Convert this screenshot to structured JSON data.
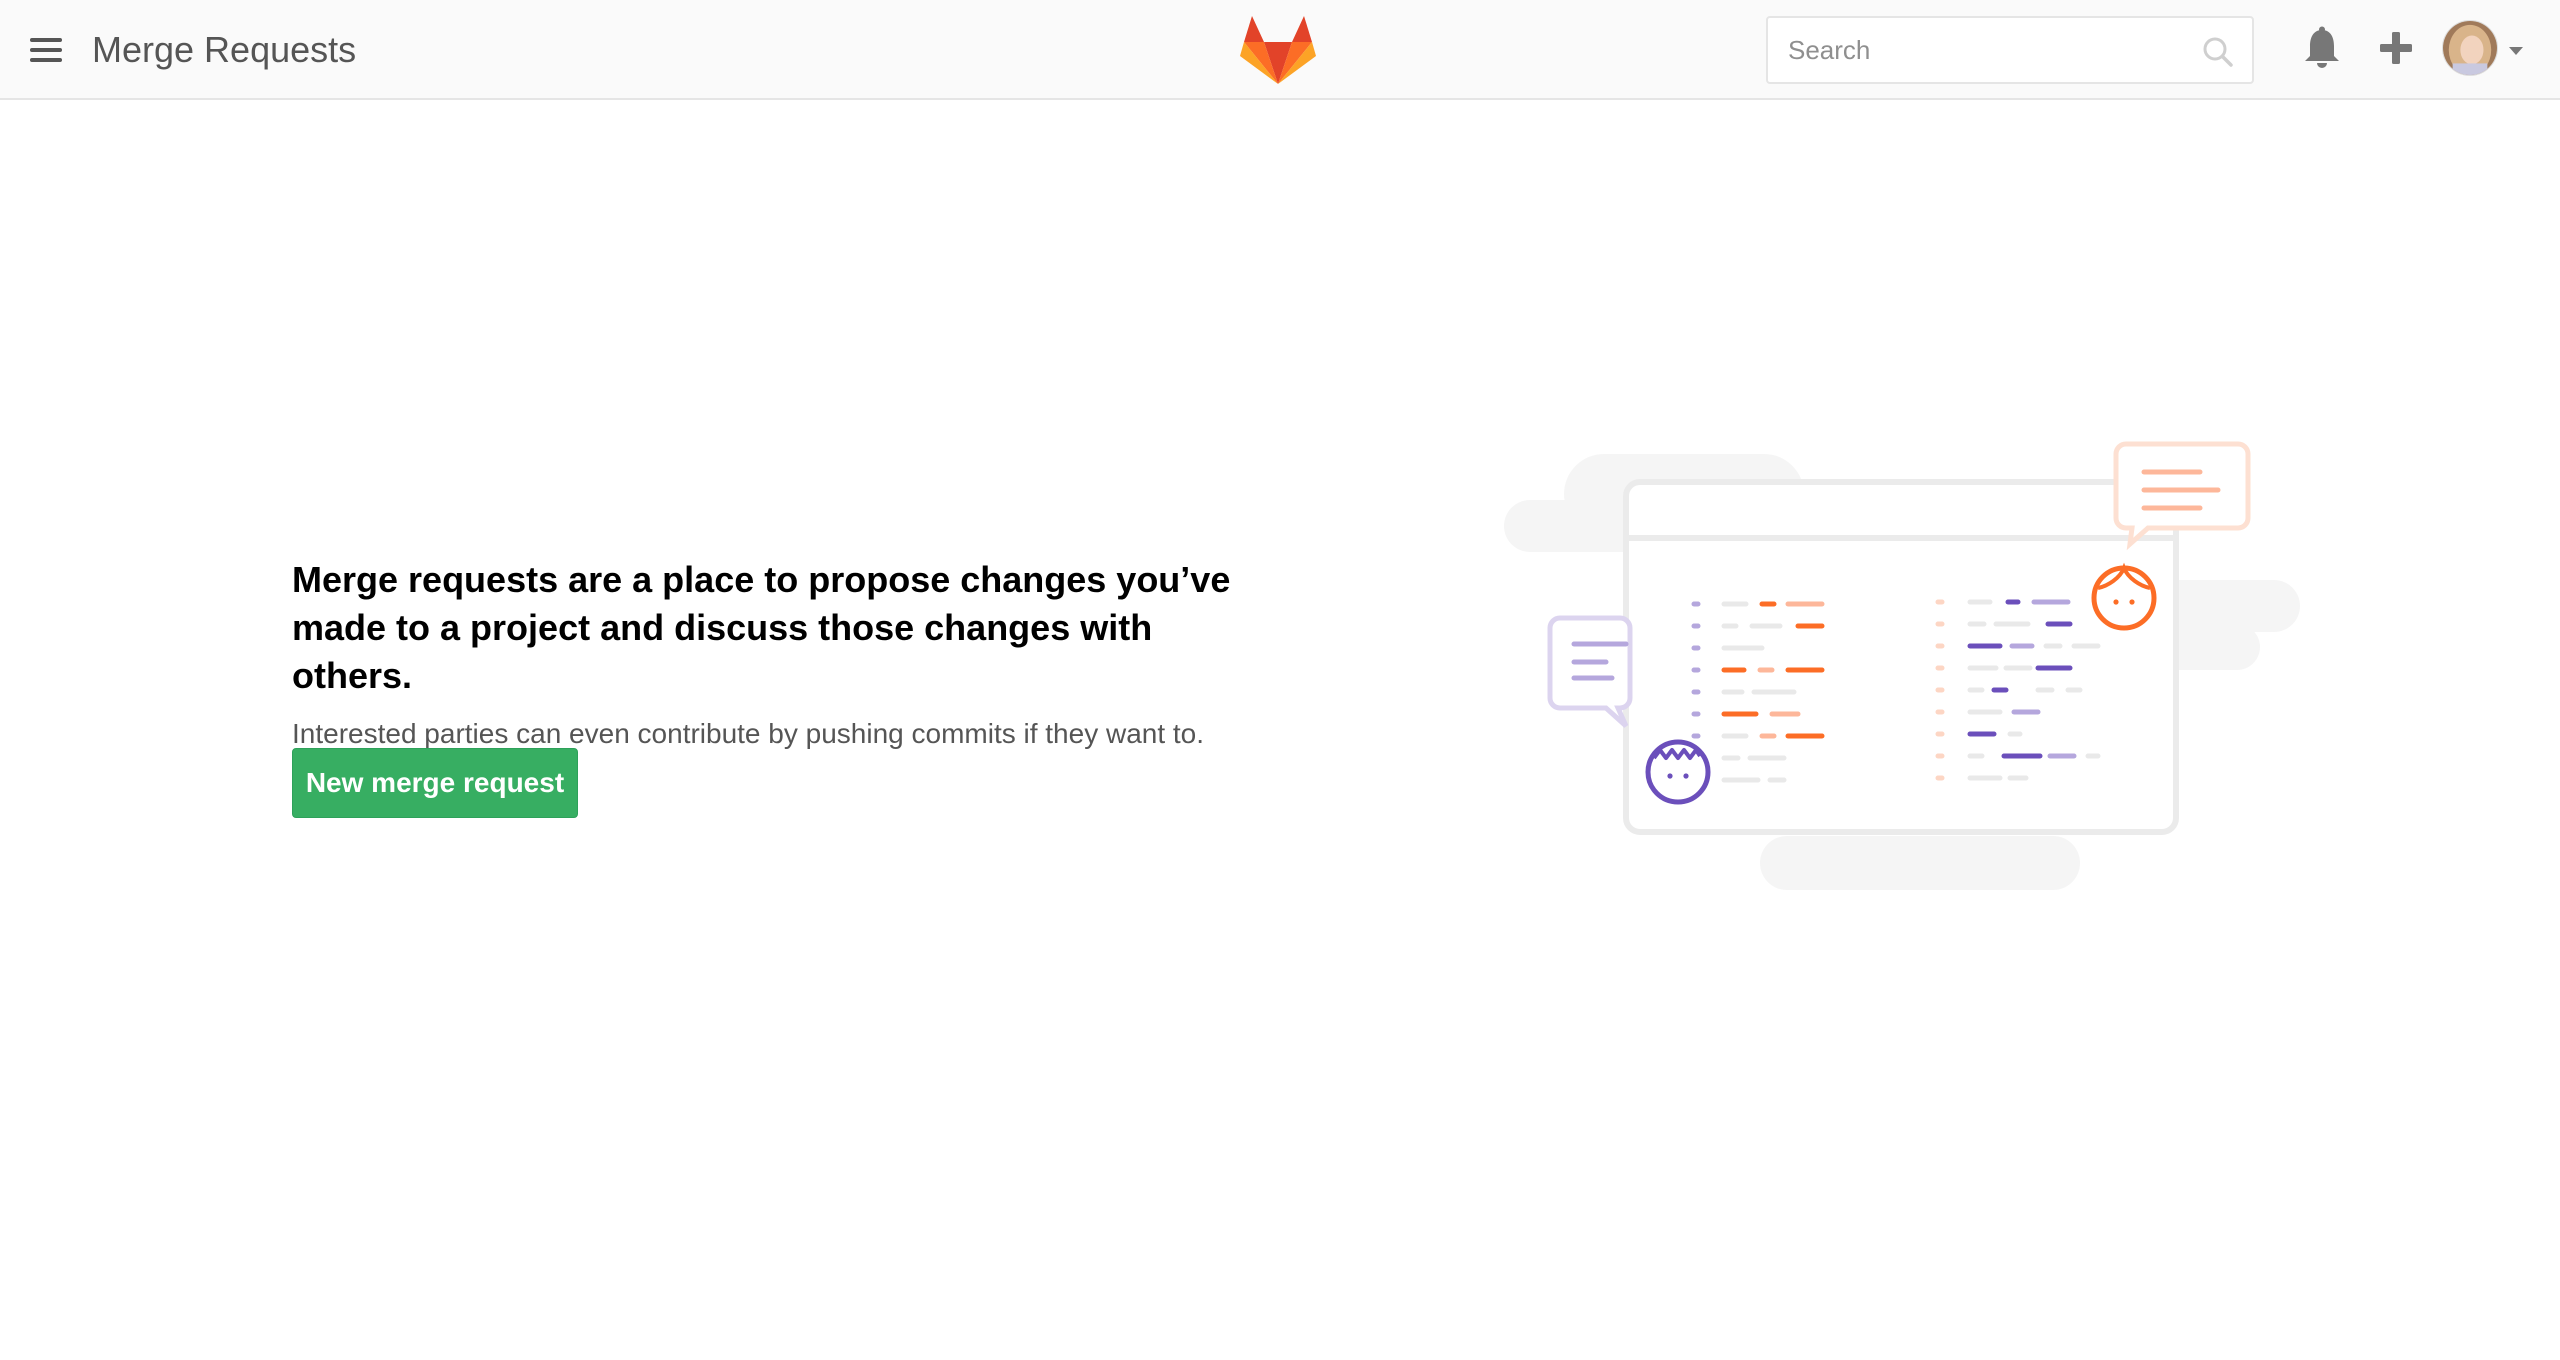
{
  "header": {
    "title": "Merge Requests",
    "search_placeholder": "Search",
    "icons": [
      "menu-icon",
      "gitlab-logo",
      "search-icon",
      "bell-icon",
      "plus-icon",
      "avatar",
      "caret-down-icon"
    ]
  },
  "empty_state": {
    "heading": "Merge requests are a place to propose changes you’ve made to a project and discuss those changes with others.",
    "subtext": "Interested parties can even contribute by pushing commits if they want to.",
    "button_label": "New merge request"
  },
  "colors": {
    "button": "#37ae62",
    "orange": "#fc6d26",
    "light_orange": "#fdb79a",
    "purple": "#6b4fbb",
    "light_purple": "#b5a7dd",
    "gray": "#e5e5e5"
  }
}
